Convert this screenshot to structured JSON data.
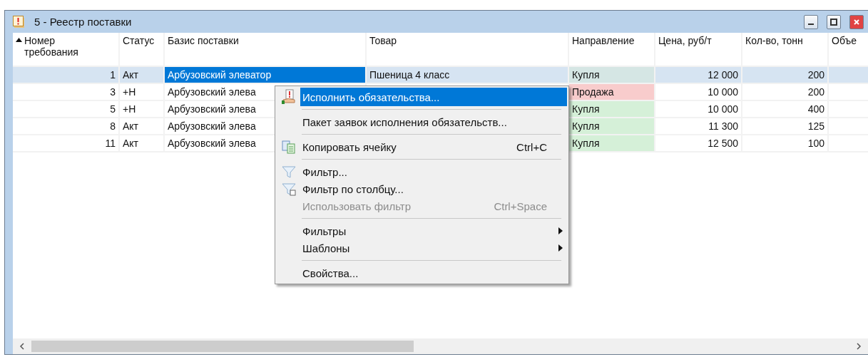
{
  "window": {
    "title": "5 - Реестр поставки"
  },
  "table": {
    "columns": [
      {
        "label": "Номер требования",
        "sorted": true
      },
      {
        "label": "Статус",
        "sorted": false
      },
      {
        "label": "Базис поставки",
        "sorted": false
      },
      {
        "label": "Товар",
        "sorted": false
      },
      {
        "label": "Направление",
        "sorted": false
      },
      {
        "label": "Цена, руб/т",
        "sorted": false
      },
      {
        "label": "Кол-во, тонн",
        "sorted": false
      },
      {
        "label": "Объе",
        "sorted": false
      }
    ],
    "rows": [
      {
        "selected": true,
        "color": "#d5e6e4",
        "cells": [
          "1",
          "Акт",
          "Арбузовский элеватор",
          "Пшеница 4 класс",
          "Купля",
          "12 000",
          "200",
          ""
        ]
      },
      {
        "selected": false,
        "color": "#f8cccc",
        "cells": [
          "3",
          "+Н",
          "Арбузовский элева",
          "",
          "Продажа",
          "10 000",
          "200",
          ""
        ]
      },
      {
        "selected": false,
        "color": "#d5f0d8",
        "cells": [
          "5",
          "+Н",
          "Арбузовский элева",
          "",
          "Купля",
          "10 000",
          "400",
          ""
        ]
      },
      {
        "selected": false,
        "color": "#d5f0d8",
        "cells": [
          "8",
          "Акт",
          "Арбузовский элева",
          "",
          "Купля",
          "11 300",
          "125",
          ""
        ]
      },
      {
        "selected": false,
        "color": "#d5f0d8",
        "cells": [
          "11",
          "Акт",
          "Арбузовский элева",
          "",
          "Купля",
          "12 500",
          "100",
          ""
        ]
      }
    ]
  },
  "context_menu": [
    {
      "kind": "item",
      "label": "Исполнить обязательства...",
      "selected": true,
      "disabled": false,
      "submenu": false
    },
    {
      "kind": "separator"
    },
    {
      "kind": "item",
      "label": "Пакет заявок исполнения обязательств...",
      "selected": false,
      "disabled": false,
      "submenu": false
    },
    {
      "kind": "separator"
    },
    {
      "kind": "item",
      "label": "Копировать ячейку",
      "shortcut": "Ctrl+C",
      "selected": false,
      "disabled": false,
      "submenu": false
    },
    {
      "kind": "separator"
    },
    {
      "kind": "item",
      "label": "Фильтр...",
      "selected": false,
      "disabled": false,
      "submenu": false
    },
    {
      "kind": "item",
      "label": "Фильтр по столбцу...",
      "selected": false,
      "disabled": false,
      "submenu": false
    },
    {
      "kind": "item",
      "label": "Использовать фильтр",
      "shortcut": "Ctrl+Space",
      "selected": false,
      "disabled": true,
      "submenu": false
    },
    {
      "kind": "separator"
    },
    {
      "kind": "item",
      "label": "Фильтры",
      "selected": false,
      "disabled": false,
      "submenu": true
    },
    {
      "kind": "item",
      "label": "Шаблоны",
      "selected": false,
      "disabled": false,
      "submenu": true
    },
    {
      "kind": "separator"
    },
    {
      "kind": "item",
      "label": "Свойства...",
      "selected": false,
      "disabled": false,
      "submenu": false
    }
  ]
}
